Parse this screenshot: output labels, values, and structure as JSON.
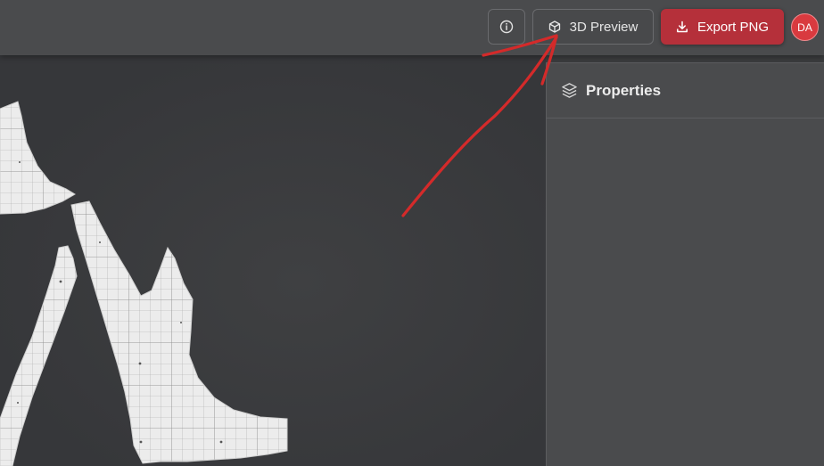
{
  "toolbar": {
    "info_icon": "info-circle-icon",
    "preview_label": "3D Preview",
    "preview_icon": "cube-icon",
    "export_label": "Export PNG",
    "export_icon": "download-icon",
    "avatar_initials": "DA"
  },
  "panel": {
    "title": "Properties",
    "icon": "layers-icon"
  },
  "colors": {
    "accent": "#b5303a",
    "avatar": "#d93a3f",
    "annotation": "#d42a2a",
    "pattern_fill": "#ececec"
  }
}
